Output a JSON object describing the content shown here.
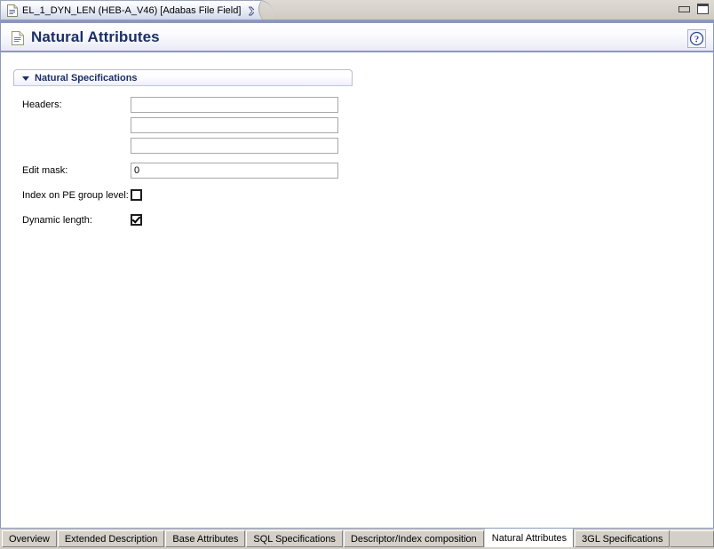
{
  "window": {
    "editor_tab": {
      "label": "EL_1_DYN_LEN (HEB-A_V46)  [Adabas File Field]",
      "doc_icon": "document-icon",
      "close_icon": "close-icon"
    },
    "minimize_icon": "minimize-icon",
    "maximize_icon": "maximize-icon"
  },
  "header": {
    "title": "Natural Attributes",
    "icon": "document-icon",
    "help_icon": "help-icon",
    "title_color": "#1b2f66"
  },
  "section": {
    "title": "Natural Specifications",
    "expanded": true,
    "twisty_icon": "chevron-down-icon"
  },
  "form": {
    "headers_label": "Headers:",
    "headers_values": [
      "",
      "",
      ""
    ],
    "headers_placeholder": "",
    "edit_mask_label": "Edit mask:",
    "edit_mask_value": "0",
    "index_pe_label": "Index on PE group level:",
    "index_pe_checked": false,
    "dynamic_length_label": "Dynamic length:",
    "dynamic_length_checked": true
  },
  "bottom_tabs": {
    "active": "Natural Attributes",
    "items": [
      {
        "label": "Overview"
      },
      {
        "label": "Extended Description"
      },
      {
        "label": "Base Attributes"
      },
      {
        "label": "SQL Specifications"
      },
      {
        "label": "Descriptor/Index composition"
      },
      {
        "label": "Natural Attributes"
      },
      {
        "label": "3GL Specifications"
      }
    ]
  }
}
